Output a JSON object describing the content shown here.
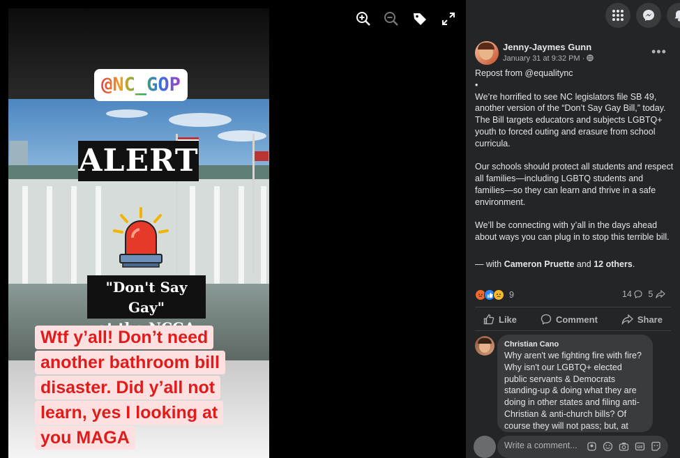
{
  "story": {
    "handle_tag": "@NC_GOP",
    "alert_text": "ALERT",
    "banner_line1": "\"Don't Say Gay\"",
    "banner_line2": "at the NCGA",
    "caption_lines": [
      "Wtf y’all! Don’t need",
      "another bathroom bill",
      "disaster. Did y’all not",
      "learn, yes I looking at",
      "you MAGA"
    ]
  },
  "viewer_tools": [
    "zoom-in-icon",
    "zoom-out-icon",
    "tag-icon",
    "fullscreen-icon"
  ],
  "top_buttons": [
    "menu-grid-icon",
    "messenger-icon",
    "notifications-icon"
  ],
  "post": {
    "author": "Jenny-Jaymes Gunn",
    "date": "January 31 at 9:32 PM ·",
    "paragraphs": [
      "Repost from @equalitync",
      "•",
      "We’re horrified to see NC legislators file SB 49, another version of the “Don’t Say Gay Bill,” today. The Bill targets educators and subjects LGBTQ+ youth to forced outing and erasure from school curricula.",
      "Our schools should protect all students and respect all families—including LGBTQ students and families—so they can learn and thrive in a safe environment.",
      "We’ll be connecting with y’all in the days ahead about ways you can plug in to stop this terrible bill."
    ],
    "with_prefix": "— with ",
    "with_name": "Cameron Pruette",
    "with_and": " and ",
    "with_others": "12 others",
    "with_suffix": ".",
    "reaction_count": "9",
    "comment_count": "14",
    "share_count": "5"
  },
  "actions": {
    "like": "Like",
    "comment": "Comment",
    "share": "Share"
  },
  "comment": {
    "name": "Christian Cano",
    "text": "Why aren't we fighting fire with fire? Why isn't our LGBTQ+ elected public servants & Democrats standing-up & doing what they are doing in other states and filing anti-Christian & anti-church bills? Of course they will not pass; but, at"
  },
  "composer": {
    "placeholder": "Write a comment..."
  },
  "colors": {
    "panel_bg": "#242526",
    "caption_red": "#e01b1b",
    "caption_bg": "#ffe0e0",
    "link_blue": "#2d88ff"
  }
}
